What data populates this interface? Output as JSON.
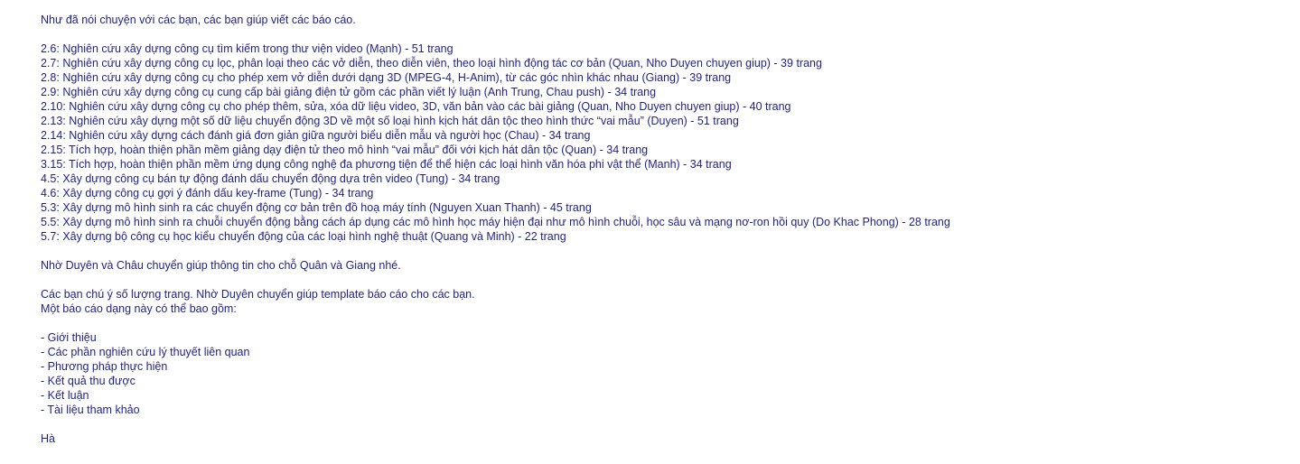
{
  "email": {
    "intro": "Như đã nói chuyện với các bạn, các bạn giúp viết các báo cáo.",
    "tasks": [
      "2.6: Nghiên cứu xây dựng công cụ tìm kiếm trong thư viện video (Mạnh) - 51 trang",
      "2.7: Nghiên cứu xây dựng công cụ lọc, phân loại theo các vở diễn, theo diễn viên, theo loại hình động tác cơ bản (Quan, Nho Duyen chuyen giup) - 39 trang",
      "2.8: Nghiên cứu xây dựng công cụ cho phép xem vở diễn dưới dạng 3D (MPEG-4, H-Anim), từ các góc nhìn khác nhau (Giang) - 39 trang",
      "2.9: Nghiên cứu xây dựng công cụ cung cấp bài giảng điện tử gồm các phần viết lý luận (Anh Trung, Chau push) - 34 trang",
      "2.10: Nghiên cứu xây dựng công cụ cho phép thêm, sửa, xóa dữ liệu video, 3D, văn bản vào các bài giảng (Quan, Nho Duyen chuyen giup) - 40 trang",
      "2.13: Nghiên cứu xây dựng một số dữ liệu chuyển động 3D về một số loại hình kịch hát dân tộc theo hình thức “vai mẫu” (Duyen) - 51 trang",
      "2.14: Nghiên cứu xây dựng cách đánh giá đơn giản giữa người biểu diễn mẫu và người học (Chau) - 34 trang",
      "2.15: Tích hợp, hoàn thiện phần mềm giảng dạy điện tử theo mô hình “vai mẫu” đối với kịch hát dân tộc (Quan) - 34 trang",
      "3.15: Tích hợp, hoàn thiện phần mềm ứng dụng công nghệ đa phương tiện để thể hiện các loại hình văn hóa phi vật thể (Manh) - 34 trang",
      "4.5: Xây dựng công cụ bán tự động đánh dấu chuyển động dựa trên video (Tung) - 34 trang",
      "4.6: Xây dựng công cụ gợi ý đánh dấu key-frame (Tung) - 34 trang",
      "5.3: Xây dựng mô hình sinh ra các chuyển động cơ bản trên đồ hoạ máy tính (Nguyen Xuan Thanh) - 45 trang",
      "5.5: Xây dựng mô hình sinh ra chuỗi chuyển động bằng cách áp dụng các mô hình học máy hiện đại như mô hình chuỗi, học sâu và mạng nơ-ron hồi quy (Do Khac Phong) - 28 trang",
      "5.7: Xây dựng bộ công cụ học kiểu chuyển động của các loại hình nghệ thuật (Quang và Minh) - 22 trang"
    ],
    "request_info": "Nhờ Duyên và Châu chuyển giúp thông tin cho chỗ Quân và Giang nhé.",
    "note_pages": "Các bạn chú ý số lượng trang. Nhờ Duyên chuyển giúp template báo cáo cho các bạn.",
    "note_structure": "Một báo cáo dạng này có thể bao gồm:",
    "sections": [
      "- Giới thiệu",
      "- Các phần nghiên cứu lý thuyết liên quan",
      "- Phương pháp thực hiện",
      "- Kết quả thu được",
      "- Kết luận",
      "- Tài liệu tham khảo"
    ],
    "signature": "Hà"
  }
}
